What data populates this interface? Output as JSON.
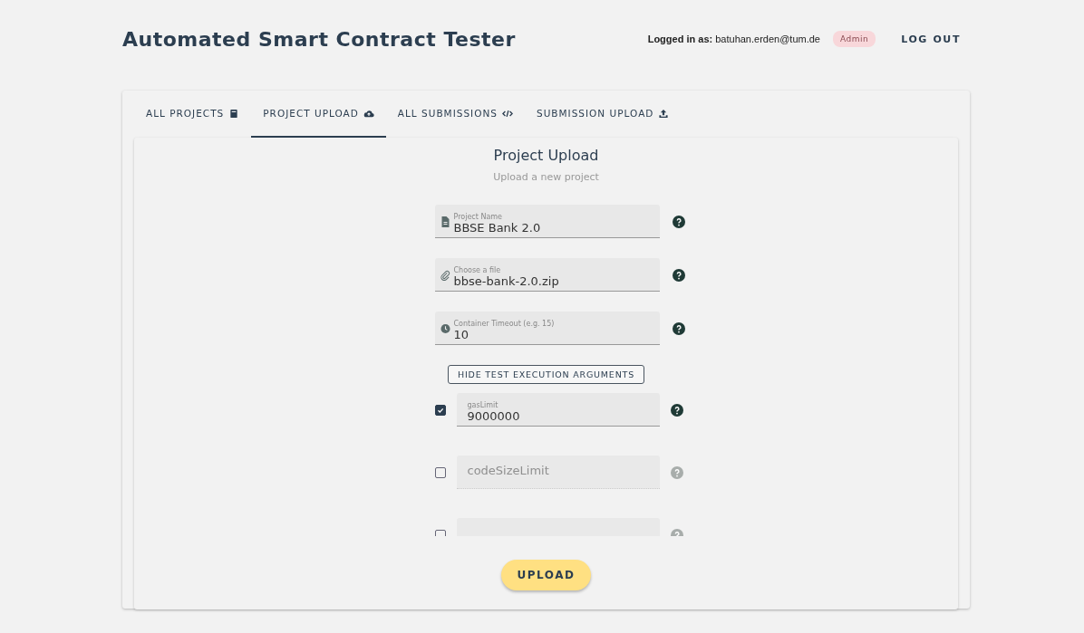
{
  "header": {
    "title": "Automated Smart Contract Tester",
    "login_label": "Logged in as:",
    "user": "batuhan.erden@tum.de",
    "role_badge": "Admin",
    "logout": "LOG OUT"
  },
  "tabs": [
    {
      "label": "ALL PROJECTS",
      "selected": false
    },
    {
      "label": "PROJECT UPLOAD",
      "selected": true
    },
    {
      "label": "ALL SUBMISSIONS",
      "selected": false
    },
    {
      "label": "SUBMISSION UPLOAD",
      "selected": false
    }
  ],
  "form": {
    "title": "Project Upload",
    "subtitle": "Upload a new project",
    "fields": [
      {
        "label": "Project Name",
        "value": "BBSE Bank 2.0"
      },
      {
        "label": "Choose a file",
        "value": "bbse-bank-2.0.zip"
      },
      {
        "label": "Container Timeout (e.g. 15)",
        "value": "10"
      }
    ],
    "toggle_button": "HIDE TEST EXECUTION ARGUMENTS",
    "arguments": [
      {
        "label": "gasLimit",
        "value": "9000000",
        "checked": true
      },
      {
        "placeholder": "codeSizeLimit",
        "checked": false
      },
      {
        "checked": false
      }
    ],
    "submit": "UPLOAD"
  }
}
